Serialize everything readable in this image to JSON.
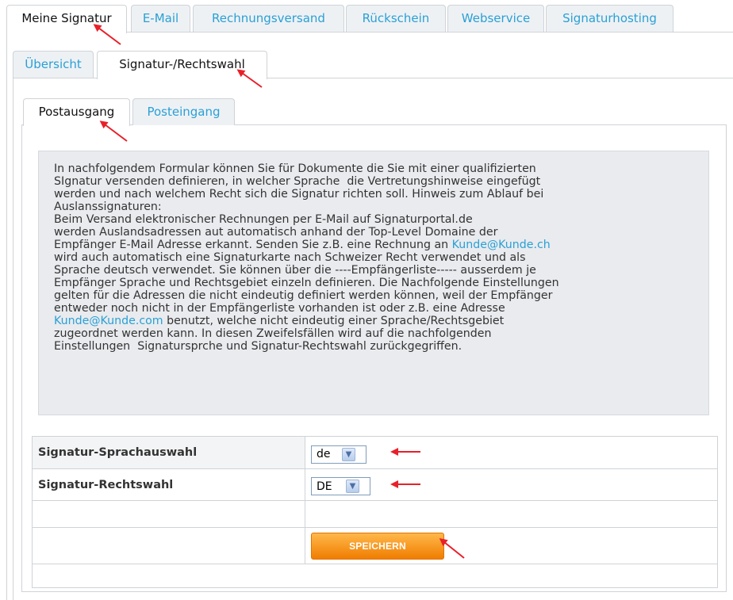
{
  "main_tabs": [
    {
      "label": "Meine Signatur",
      "active": true
    },
    {
      "label": "E-Mail",
      "active": false
    },
    {
      "label": "Rechnungsversand",
      "active": false
    },
    {
      "label": "Rückschein",
      "active": false
    },
    {
      "label": "Webservice",
      "active": false
    },
    {
      "label": "Signaturhosting",
      "active": false
    }
  ],
  "sub_tabs": [
    {
      "label": "Übersicht",
      "active": false
    },
    {
      "label": "Signatur-/Rechtswahl",
      "active": true
    }
  ],
  "mail_tabs": [
    {
      "label": "Postausgang",
      "active": true
    },
    {
      "label": "Posteingang",
      "active": false
    }
  ],
  "info": {
    "text_1": "In nachfolgendem Formular können Sie für Dokumente die Sie mit einer qualifizierten\nSIgnatur versenden definieren, in welcher Sprache  die Vertretungshinweise eingefügt\nwerden und nach welchem Recht sich die Signatur richten soll. Hinweis zum Ablauf bei\nAuslanssignaturen:\nBeim Versand elektronischer Rechnungen per E-Mail auf Signaturportal.de\nwerden Auslandsadressen aut automatisch anhand der Top-Level Domaine der\nEmpfänger E-Mail Adresse erkannt. Senden Sie z.B. eine Rechnung an ",
    "link_1": "Kunde@Kunde.ch",
    "text_2": "\nwird auch automatisch eine Signaturkarte nach Schweizer Recht verwendet und als\nSprache deutsch verwendet. Sie können über die ----Empfängerliste----- ausserdem je\nEmpfänger Sprache und Rechtsgebiet einzeln definieren. Die Nachfolgende Einstellungen\ngelten für die Adressen die nicht eindeutig definiert werden können, weil der Empfänger\nentweder noch nicht in der Empfängerliste vorhanden ist oder z.B. eine Adresse\n",
    "link_2": "Kunde@Kunde.com",
    "text_3": " benutzt, welche nicht eindeutig einer Sprache/Rechtsgebiet\nzugeordnet werden kann. In diesen Zweifelsfällen wird auf die nachfolgenden\nEinstellungen  Signatursprche und Signatur-Rechtswahl zurückgegriffen."
  },
  "form": {
    "language_label": "Signatur-Sprachauswahl",
    "language_value": "de",
    "law_label": "Signatur-Rechtswahl",
    "law_value": "DE",
    "save_label": "SPEICHERN"
  },
  "colors": {
    "link": "#2aa0d6",
    "annotation_arrow": "#e8202a",
    "save_button": "#f28a0c"
  }
}
